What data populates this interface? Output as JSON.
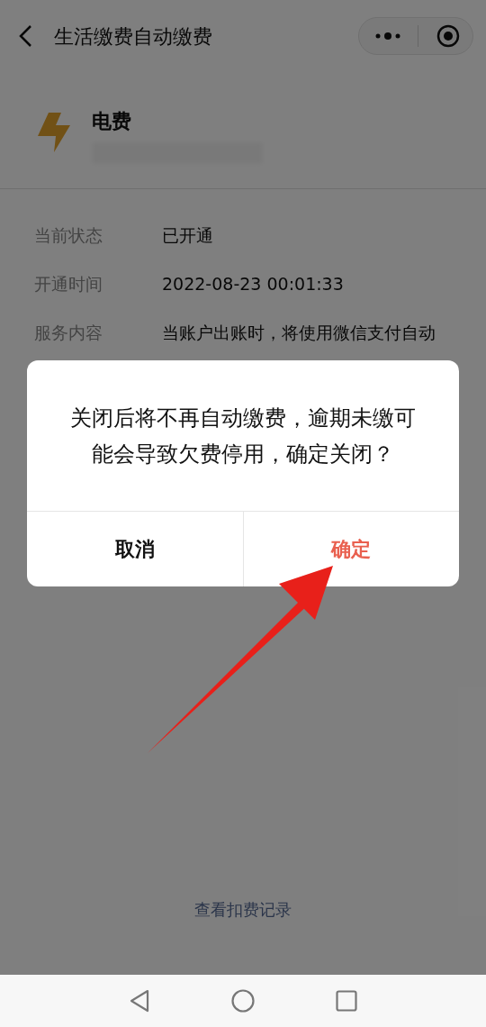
{
  "nav": {
    "title": "生活缴费自动缴费"
  },
  "biller": {
    "name": "电费"
  },
  "details": [
    {
      "label": "当前状态",
      "value": "已开通"
    },
    {
      "label": "开通时间",
      "value": "2022-08-23 00:01:33"
    },
    {
      "label": "服务内容",
      "value": "当账户出账时，将使用微信支付自动"
    }
  ],
  "link": "查看扣费记录",
  "dialog": {
    "message": "关闭后将不再自动缴费，逾期未缴可能会导致欠费停用，确定关闭？",
    "buttons": [
      {
        "label": "取消",
        "kind": "cancel"
      },
      {
        "label": "确定",
        "kind": "confirm"
      }
    ]
  }
}
